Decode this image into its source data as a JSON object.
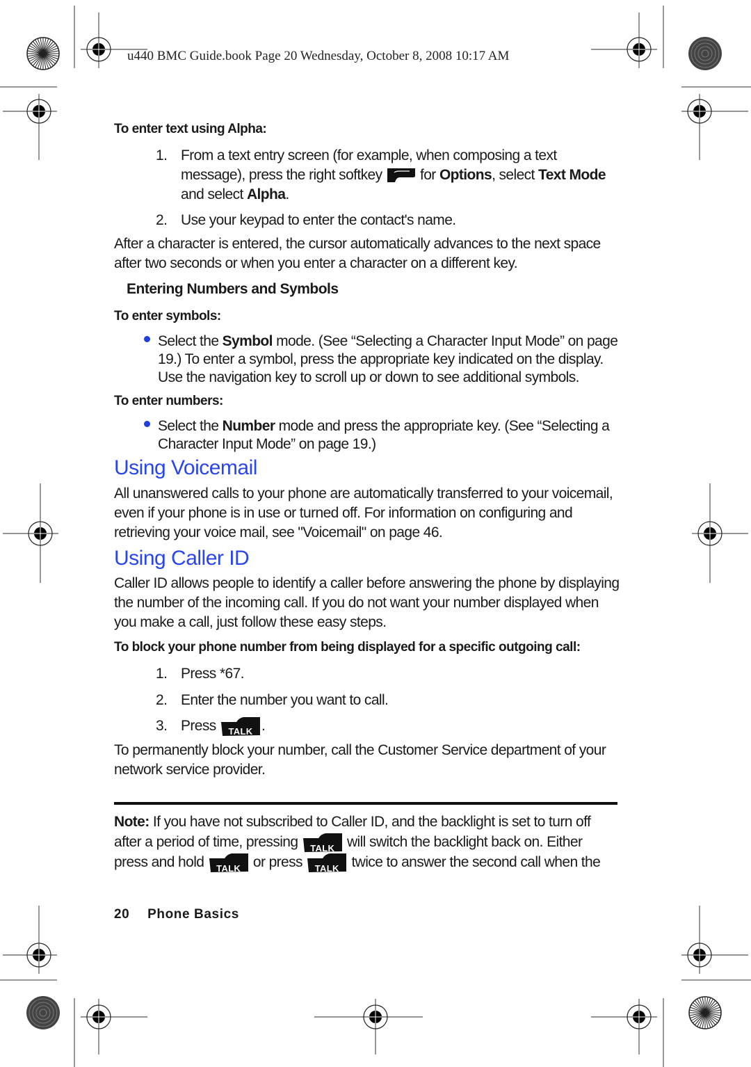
{
  "header": {
    "print_line": "u440 BMC Guide.book  Page 20  Wednesday, October 8, 2008  10:17 AM"
  },
  "alpha_section": {
    "heading": "To enter text using Alpha:",
    "step1": {
      "num": "1.",
      "line1": "From a text entry screen (for example, when composing a text",
      "line2_pre": "message), press the right softkey",
      "icon": "right-softkey-icon",
      "line2_for": " for ",
      "options": "Options",
      "line2_mid": ", select ",
      "text_mode": "Text Mode",
      "line3_pre": "and select ",
      "alpha": "Alpha",
      "line3_post": "."
    },
    "step2": {
      "num": "2.",
      "text": "Use your keypad to enter the contact's name."
    },
    "paragraph": [
      "After a character is entered, the cursor automatically advances to the next space",
      "after two seconds or when you enter a character on a different key."
    ]
  },
  "numbers_symbols": {
    "heading": "Entering Numbers and Symbols",
    "symbols_heading": "To enter symbols:",
    "symbols_bullet": {
      "pre": "Select the ",
      "bold": "Symbol",
      "post": " mode. (See “Selecting a Character Input Mode” on page",
      "line2": "19.) To enter a symbol, press the appropriate key indicated on the display.",
      "line3": "Use the navigation key to scroll up or down to see additional symbols."
    },
    "numbers_heading": "To enter numbers:",
    "numbers_bullet": {
      "pre": "Select the ",
      "bold": "Number",
      "post": " mode and press the appropriate key. (See “Selecting a",
      "line2": "Character Input Mode” on page 19.)"
    }
  },
  "voicemail": {
    "title": "Using Voicemail",
    "paragraph": [
      "All unanswered calls to your phone are automatically transferred to your voicemail,",
      "even if your phone is in use or turned off. For information on configuring and",
      "retrieving your voice mail, see \"Voicemail\" on page 46."
    ]
  },
  "caller_id": {
    "title": "Using Caller ID",
    "paragraph": [
      "Caller ID allows people to identify a caller before answering the phone by displaying",
      "the number of the incoming call. If you do not want your number displayed when",
      "you make a call, just follow these easy steps."
    ],
    "block_heading": "To block your phone number from being displayed for a specific outgoing call:",
    "steps": [
      {
        "num": "1.",
        "text": "Press *67."
      },
      {
        "num": "2.",
        "text": "Enter the number you want to call."
      },
      {
        "num": "3.",
        "text": "Press",
        "after": "."
      }
    ],
    "talk_key_label": "TALK",
    "permanent": [
      "To permanently block your number, call the Customer Service department of your",
      "network service provider."
    ]
  },
  "note": {
    "label": "Note:",
    "line1": " If you have not subscribed to Caller ID, and the backlight is set to turn off",
    "line2_pre": "after a period of time, pressing",
    "line2_post": "will switch the backlight back on. Either",
    "line3_pre": "press and hold",
    "line3_mid": "or press",
    "line3_post": "twice to answer the second call when the"
  },
  "footer": {
    "page_number": "20",
    "section": "Phone Basics"
  },
  "colors": {
    "heading_blue": "#2845f0",
    "bullet_blue": "#1f3fe0",
    "text": "#1a1a1a"
  }
}
